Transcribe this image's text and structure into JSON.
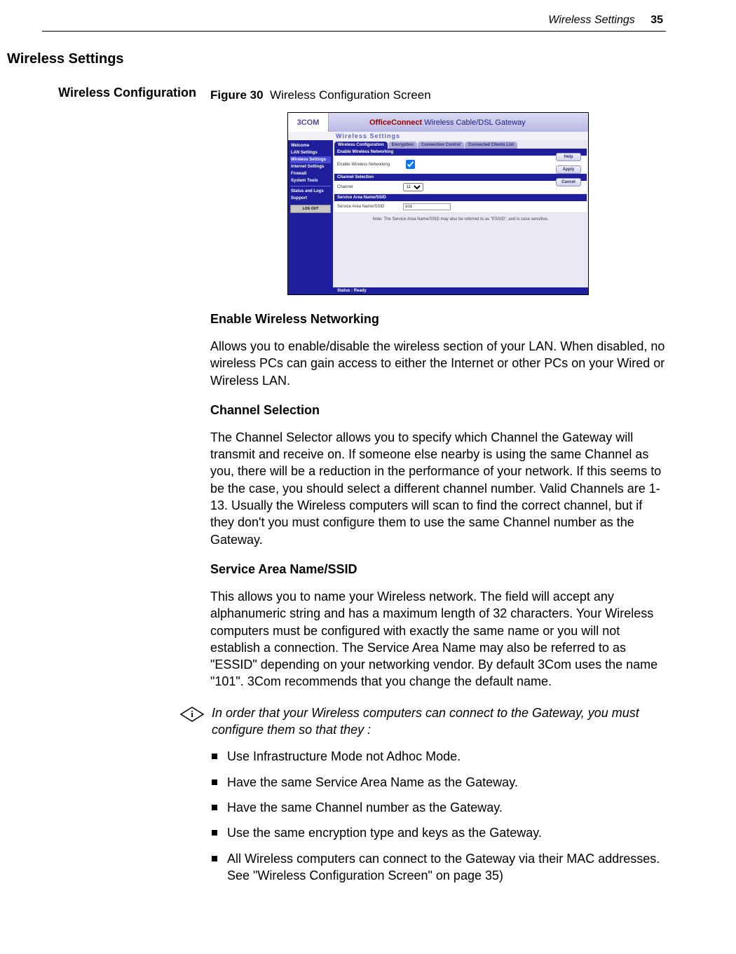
{
  "running_header": {
    "title": "Wireless Settings",
    "page": "35"
  },
  "section_heading": "Wireless Settings",
  "side_label": "Wireless Configuration",
  "figure": {
    "label": "Figure 30",
    "caption": "Wireless Configuration Screen"
  },
  "screenshot": {
    "logo": "3COM",
    "brand_pre": "OfficeConnect",
    "brand_post": " Wireless Cable/DSL Gateway",
    "subtitle": "Wireless Settings",
    "nav": [
      "Welcome",
      "LAN Settings",
      "Wireless Settings",
      "Internet Settings",
      "Firewall",
      "System Tools",
      "Status and Logs",
      "Support"
    ],
    "nav_selected_index": 2,
    "logout": "LOG OUT",
    "tabs": [
      "Wireless Configuration",
      "Encryption",
      "Connection Control",
      "Connected Clients List"
    ],
    "tabs_selected_index": 0,
    "panel1": {
      "title": "Enable Wireless Networking",
      "label": "Enable Wireless Networking",
      "checked": true
    },
    "panel2": {
      "title": "Channel Selection",
      "label": "Channel",
      "value": "11"
    },
    "panel3": {
      "title": "Service Area Name/SSID",
      "label": "Service Area Name/SSID",
      "value": "101"
    },
    "note": "Note: The Service Area Name/SSID may also be referred to as \"ESSID\", and is case sensitive.",
    "buttons": [
      "Help",
      "Apply",
      "Cancel"
    ],
    "status": "Status : Ready"
  },
  "sub1_heading": "Enable Wireless Networking",
  "sub1_body": "Allows you to enable/disable the wireless section of your LAN. When disabled, no wireless PCs can gain access to either the Internet or other PCs on your Wired or Wireless LAN.",
  "sub2_heading": "Channel Selection",
  "sub2_body": "The Channel Selector allows you to specify which Channel the Gateway will transmit and receive on. If someone else nearby is using the same Channel as you, there will be a reduction in the performance of your network. If this seems to be the case, you should select a different channel number. Valid Channels are 1- 13. Usually the Wireless computers will scan to find the correct channel, but if they don't you must configure them to use the same Channel number as the Gateway.",
  "sub3_heading": "Service Area Name/SSID",
  "sub3_body": "This allows you to name your Wireless network. The field will accept any alphanumeric string and has a maximum length of 32 characters. Your Wireless computers must be configured with exactly the same name or you will not establish a connection. The Service Area Name may also be referred to as \"ESSID\" depending on your networking vendor. By default 3Com uses the name \"101\". 3Com recommends that you change the default name.",
  "note_text": "In order that your Wireless computers can connect to the Gateway, you must configure them so that they :",
  "bullets": [
    "Use Infrastructure Mode not Adhoc Mode.",
    "Have the same Service Area Name as the Gateway.",
    "Have the same Channel number as the Gateway.",
    "Use the same encryption type and keys as the Gateway.",
    "All Wireless computers can connect to the Gateway via their MAC addresses. See \"Wireless Configuration Screen\" on page 35)"
  ]
}
